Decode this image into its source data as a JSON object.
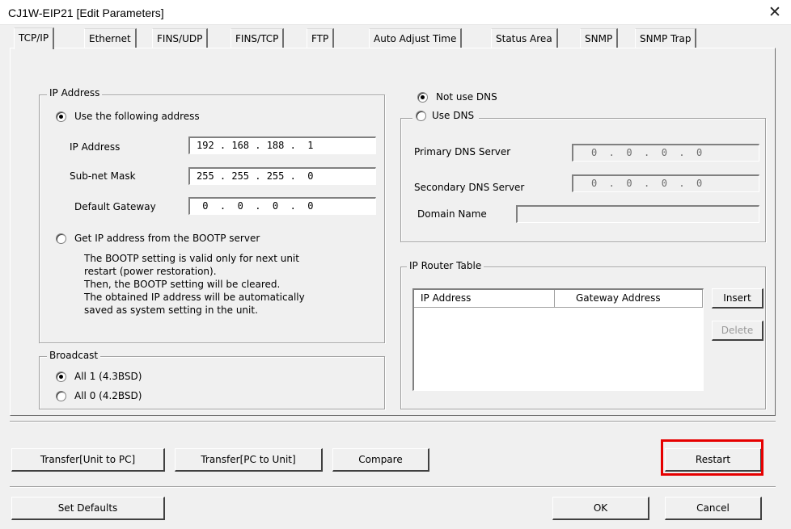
{
  "window": {
    "title": "CJ1W-EIP21 [Edit Parameters]",
    "close_glyph": "✕"
  },
  "tabs": [
    {
      "label": "TCP/IP",
      "active": true
    },
    {
      "label": "Ethernet"
    },
    {
      "label": "FINS/UDP"
    },
    {
      "label": "FINS/TCP"
    },
    {
      "label": "FTP"
    },
    {
      "label": "Auto Adjust Time"
    },
    {
      "label": "Status Area"
    },
    {
      "label": "SNMP"
    },
    {
      "label": "SNMP Trap"
    }
  ],
  "ip_address_group": {
    "legend": "IP Address",
    "use_following_label": "Use the following address",
    "use_following_selected": true,
    "ip_label": "IP Address",
    "ip_value": "192 . 168 . 188 .  1",
    "mask_label": "Sub-net Mask",
    "mask_value": "255 . 255 . 255 .  0",
    "gateway_label": "Default Gateway",
    "gateway_value": " 0  .  0  .  0  .  0",
    "bootp_label": "Get IP address from the BOOTP server",
    "bootp_selected": false,
    "bootp_note": "The BOOTP setting is valid only for next unit\nrestart (power restoration).\nThen, the BOOTP setting will be cleared.\nThe obtained IP address will be automatically\nsaved as system setting in the unit."
  },
  "broadcast_group": {
    "legend": "Broadcast",
    "all1_label": "All 1 (4.3BSD)",
    "all1_selected": true,
    "all0_label": "All 0 (4.2BSD)",
    "all0_selected": false
  },
  "dns": {
    "not_use_label": "Not use DNS",
    "not_use_selected": true,
    "use_label": "Use DNS",
    "use_selected": false,
    "primary_label": "Primary DNS Server",
    "primary_value": "0  .  0  .  0  .  0",
    "secondary_label": "Secondary DNS Server",
    "secondary_value": "0  .  0  .  0  .  0",
    "domain_label": "Domain Name",
    "domain_value": ""
  },
  "router_table": {
    "legend": "IP Router Table",
    "columns": [
      "IP Address",
      "Gateway Address"
    ],
    "rows": [],
    "insert_label": "Insert",
    "delete_label": "Delete"
  },
  "bottom_buttons": {
    "transfer_unit_to_pc": "Transfer[Unit to PC]",
    "transfer_pc_to_unit": "Transfer[PC to Unit]",
    "compare": "Compare",
    "restart": "Restart",
    "set_defaults": "Set Defaults",
    "ok": "OK",
    "cancel": "Cancel"
  },
  "colors": {
    "highlight": "#e60000",
    "dialog_bg": "#f0f0f0"
  }
}
